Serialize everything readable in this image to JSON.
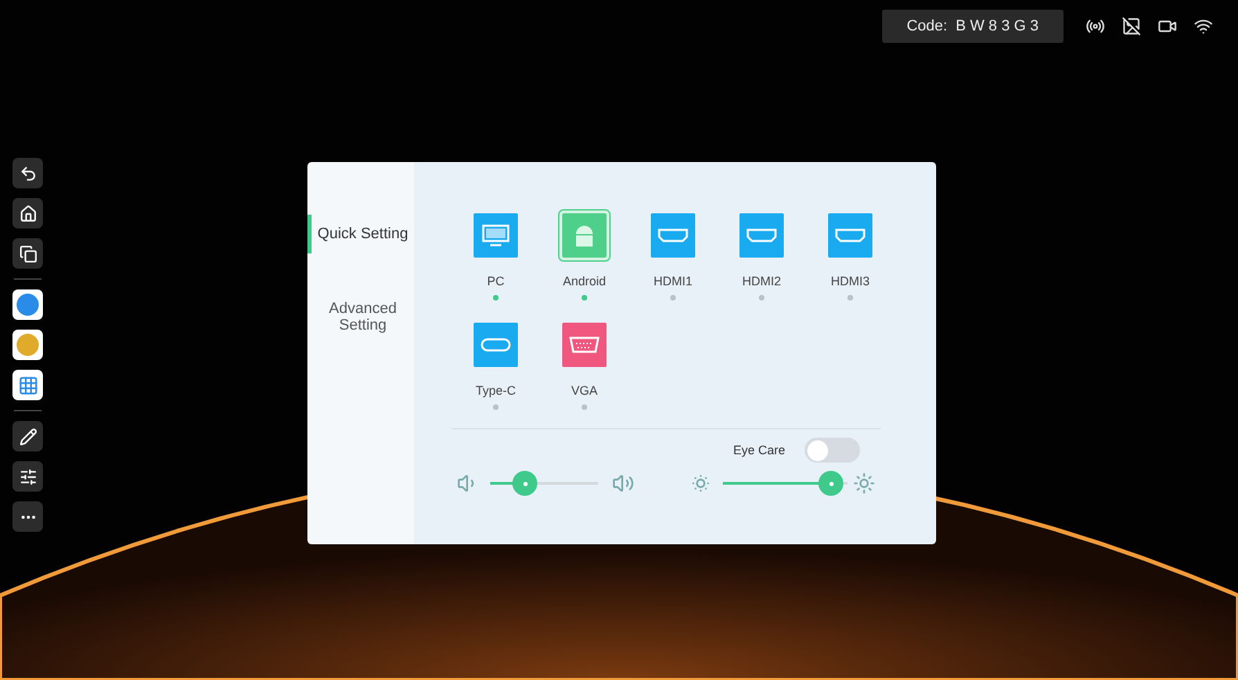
{
  "status_bar": {
    "code_label": "Code:",
    "code": "B W 8 3 G 3"
  },
  "toolbar": [
    {
      "kind": "back"
    },
    {
      "kind": "home"
    },
    {
      "kind": "windows"
    },
    {
      "kind": "divider"
    },
    {
      "kind": "app",
      "color": "#2b8be8"
    },
    {
      "kind": "app",
      "color": "#e0aa2a"
    },
    {
      "kind": "apps"
    },
    {
      "kind": "divider"
    },
    {
      "kind": "pen"
    },
    {
      "kind": "sliders"
    },
    {
      "kind": "more"
    }
  ],
  "tabs": [
    {
      "label": "Quick Setting",
      "selected": true
    },
    {
      "label": "Advanced Setting",
      "selected": false
    }
  ],
  "sources": [
    {
      "label": "PC",
      "kind": "monitor",
      "color": "#1aaaf0",
      "selected": false,
      "active": true
    },
    {
      "label": "Android",
      "kind": "android",
      "color": "#4fd08a",
      "selected": true,
      "active": true
    },
    {
      "label": "HDMI1",
      "kind": "hdmi",
      "color": "#1aaaf0",
      "selected": false,
      "active": false
    },
    {
      "label": "HDMI2",
      "kind": "hdmi",
      "color": "#1aaaf0",
      "selected": false,
      "active": false
    },
    {
      "label": "HDMI3",
      "kind": "hdmi",
      "color": "#1aaaf0",
      "selected": false,
      "active": false
    },
    {
      "label": "Type-C",
      "kind": "typec",
      "color": "#1aaaf0",
      "selected": false,
      "active": false
    },
    {
      "label": "VGA",
      "kind": "vga",
      "color": "#f0577e",
      "selected": false,
      "active": false
    }
  ],
  "eye_care": {
    "label": "Eye Care",
    "on": false
  },
  "volume": {
    "level": 0.27
  },
  "brightness": {
    "level": 0.96
  }
}
